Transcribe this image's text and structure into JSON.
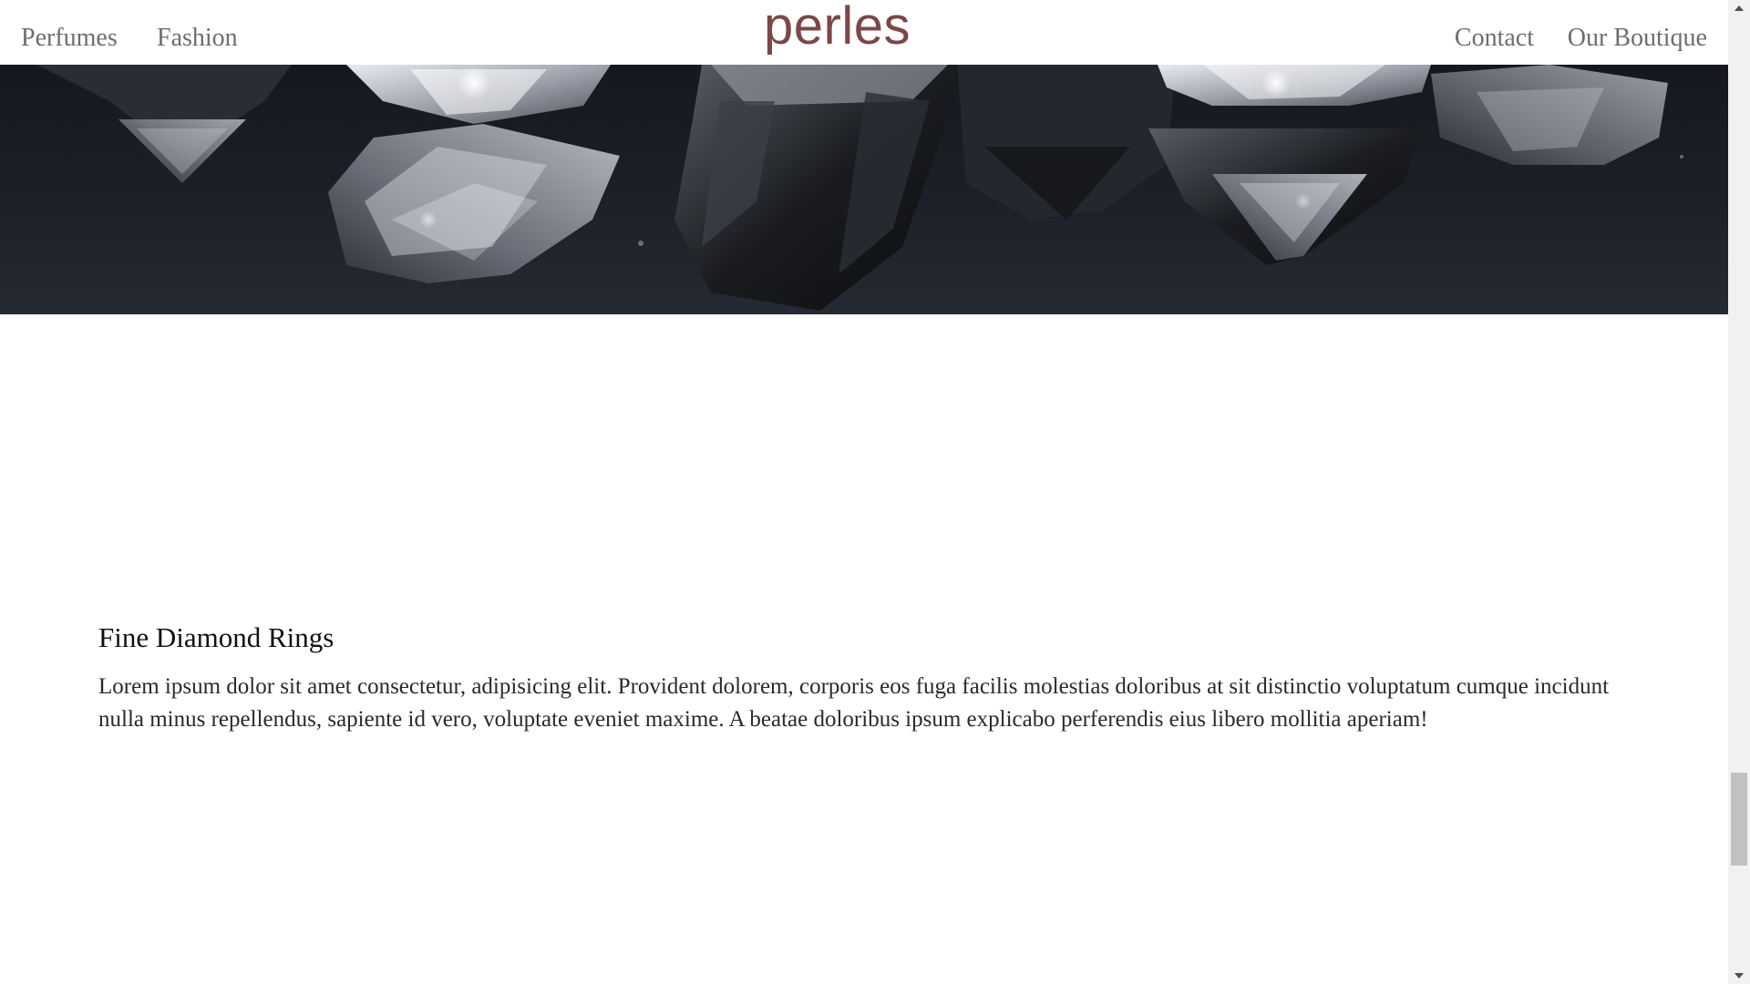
{
  "header": {
    "nav_left": [
      "Perfumes",
      "Fashion"
    ],
    "brand": "perles",
    "nav_right": [
      "Contact",
      "Our Boutique"
    ]
  },
  "hero": {
    "image_icon": "diamonds-photo"
  },
  "content": {
    "heading": "Fine Diamond Rings",
    "body": "Lorem ipsum dolor sit amet consectetur, adipisicing elit. Provident dolorem, corporis eos fuga facilis molestias doloribus at sit distinctio voluptatum cumque incidunt nulla minus repellendus, sapiente id vero, voluptate eveniet maxime. A beatae doloribus ipsum explicabo perferendis eius libero mollitia aperiam!"
  },
  "colors": {
    "brand": "#7a4848",
    "nav_text": "#6d6d6d",
    "hero_background": "#1d2028"
  },
  "scrollbar": {
    "position_fraction": 0.83
  }
}
